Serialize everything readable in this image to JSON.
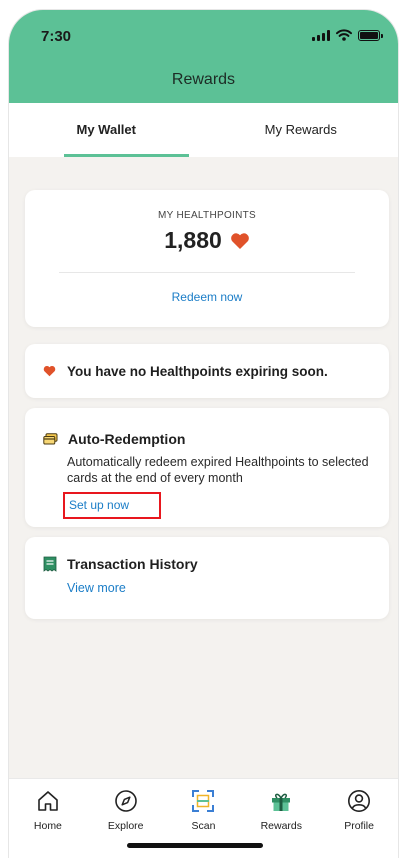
{
  "status_bar": {
    "time": "7:30"
  },
  "header": {
    "title": "Rewards"
  },
  "tabs": [
    {
      "label": "My Wallet",
      "active": true
    },
    {
      "label": "My Rewards",
      "active": false
    }
  ],
  "healthpoints": {
    "label": "MY HEALTHPOINTS",
    "value": "1,880",
    "redeem_label": "Redeem now"
  },
  "expiry": {
    "message": "You have no Healthpoints expiring soon."
  },
  "auto_redemption": {
    "title": "Auto-Redemption",
    "description": "Automatically redeem expired Healthpoints to selected cards at the end of every month",
    "link": "Set up now"
  },
  "transaction_history": {
    "title": "Transaction History",
    "link": "View more"
  },
  "bottom_nav": [
    {
      "label": "Home",
      "icon": "home-icon"
    },
    {
      "label": "Explore",
      "icon": "compass-icon"
    },
    {
      "label": "Scan",
      "icon": "scan-icon"
    },
    {
      "label": "Rewards",
      "icon": "gift-icon"
    },
    {
      "label": "Profile",
      "icon": "profile-icon"
    }
  ],
  "colors": {
    "brand_green": "#5cc196",
    "link_blue": "#1b7dc7",
    "heart_orange": "#e0522a",
    "highlight_red": "#e8171e"
  }
}
